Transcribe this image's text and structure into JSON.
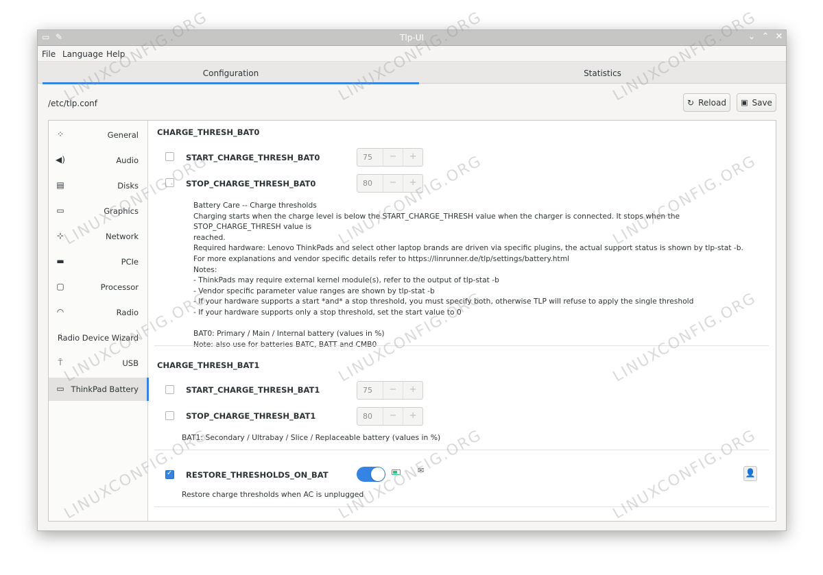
{
  "window": {
    "title": "Tlp-UI"
  },
  "menu": [
    "File",
    "Language",
    "Help"
  ],
  "tabs": [
    {
      "label": "Configuration",
      "active": true
    },
    {
      "label": "Statistics",
      "active": false
    }
  ],
  "toolbar": {
    "config_path": "/etc/tlp.conf",
    "reload_label": "Reload",
    "save_label": "Save"
  },
  "sidebar": {
    "items": [
      {
        "label": "General",
        "icon": "settings-grid-icon"
      },
      {
        "label": "Audio",
        "icon": "speaker-icon"
      },
      {
        "label": "Disks",
        "icon": "disk-icon"
      },
      {
        "label": "Graphics",
        "icon": "monitor-icon"
      },
      {
        "label": "Network",
        "icon": "network-icon"
      },
      {
        "label": "PCIe",
        "icon": "pcie-icon"
      },
      {
        "label": "Processor",
        "icon": "processor-icon"
      },
      {
        "label": "Radio",
        "icon": "wifi-icon"
      },
      {
        "label": "Radio Device Wizard",
        "icon": "radio-wizard-icon"
      },
      {
        "label": "USB",
        "icon": "usb-icon"
      },
      {
        "label": "ThinkPad Battery",
        "icon": "battery-icon",
        "active": true
      }
    ]
  },
  "bat0": {
    "title": "CHARGE_THRESH_BAT0",
    "start": {
      "label": "START_CHARGE_THRESH_BAT0",
      "value": "75",
      "checked": false
    },
    "stop": {
      "label": "STOP_CHARGE_THRESH_BAT0",
      "value": "80",
      "checked": false
    },
    "description": [
      "Battery Care -- Charge thresholds",
      "Charging starts when the charge level is below the START_CHARGE_THRESH value when the charger is connected. It stops when the STOP_CHARGE_THRESH value is",
      "reached.",
      "Required hardware: Lenovo ThinkPads and select other laptop brands are driven via specific plugins, the actual support status is shown by tlp-stat -b.",
      "For more explanations and vendor specific details refer to https://linrunner.de/tlp/settings/battery.html",
      "Notes:",
      "- ThinkPads may require external kernel module(s), refer to the output of tlp-stat -b",
      "- Vendor specific parameter value ranges are shown by tlp-stat -b",
      "- If your hardware supports a start *and* a stop threshold, you must specify both, otherwise TLP will refuse to apply the single threshold",
      "- If your hardware supports only a stop threshold, set the start value to 0",
      "",
      "BAT0: Primary / Main / Internal battery (values in %)",
      "Note: also use for batteries BATC, BATT and CMB0"
    ]
  },
  "bat1": {
    "title": "CHARGE_THRESH_BAT1",
    "start": {
      "label": "START_CHARGE_THRESH_BAT1",
      "value": "75",
      "checked": false
    },
    "stop": {
      "label": "STOP_CHARGE_THRESH_BAT1",
      "value": "80",
      "checked": false
    },
    "note": "BAT1: Secondary / Ultrabay / Slice / Replaceable battery (values in %)"
  },
  "restore": {
    "label": "RESTORE_THRESHOLDS_ON_BAT",
    "checked": true,
    "toggle_on": true,
    "note": "Restore charge thresholds when AC is unplugged"
  },
  "watermark": "LINUXCONFIG.ORG",
  "colors": {
    "accent": "#3584e4",
    "battery_green": "#2ec27e"
  }
}
